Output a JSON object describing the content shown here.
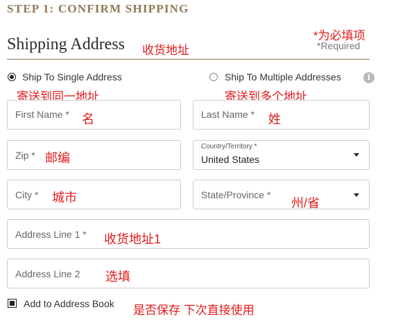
{
  "step_title": "STEP 1: CONFIRM SHIPPING",
  "section": {
    "title": "Shipping Address",
    "title_cn": "收货地址",
    "required_cn": "*为必填项",
    "required": "*Required"
  },
  "shipping_options": {
    "single": {
      "label": "Ship To Single Address",
      "label_cn": "寄送到同一地址",
      "selected": true
    },
    "multiple": {
      "label": "Ship To Multiple Addresses",
      "label_cn": "寄送到多个地址",
      "selected": false
    },
    "info_icon": "info-icon"
  },
  "fields": {
    "first_name": {
      "placeholder": "First Name *",
      "note_cn": "名"
    },
    "last_name": {
      "placeholder": "Last Name *",
      "note_cn": "姓"
    },
    "zip": {
      "placeholder": "Zip *",
      "note_cn": "邮编"
    },
    "country": {
      "label": "Country/Territory *",
      "value": "United States"
    },
    "city": {
      "placeholder": "City *",
      "note_cn": "城市"
    },
    "state": {
      "placeholder": "State/Province *",
      "note_cn": "州/省"
    },
    "address1": {
      "placeholder": "Address Line 1 *",
      "note_cn": "收货地址1"
    },
    "address2": {
      "placeholder": "Address Line 2",
      "note_cn": "选填"
    }
  },
  "address_book": {
    "label": "Add to Address Book",
    "label_cn": "是否保存 下次直接使用",
    "checked": true
  },
  "colors": {
    "accent": "#8d7a56",
    "annotation": "#e21b1b",
    "border": "#cccccc"
  }
}
